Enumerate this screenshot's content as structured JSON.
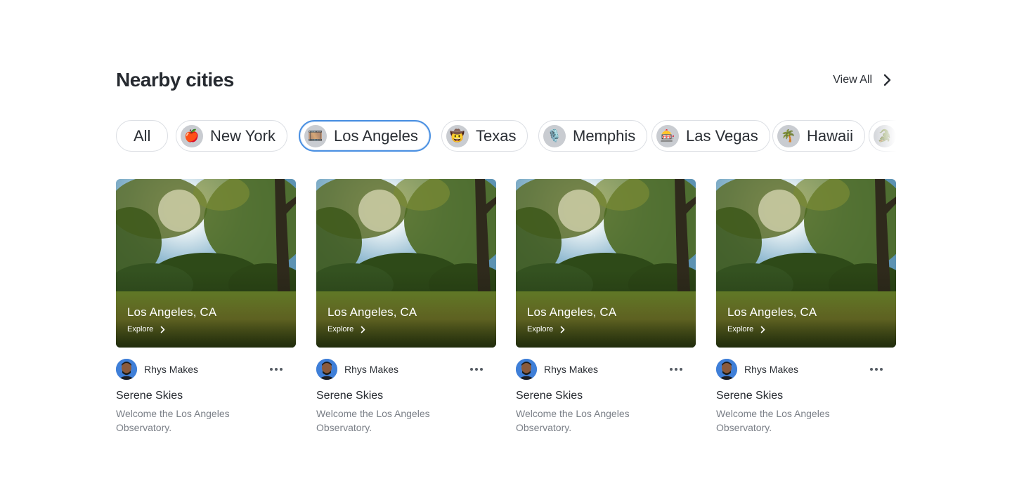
{
  "header": {
    "title": "Nearby cities",
    "view_all_label": "View All",
    "view_all_icon": "chevron-right-icon"
  },
  "chips": [
    {
      "label": "All",
      "icon": null,
      "selected": false
    },
    {
      "label": "New York",
      "icon": "🍎",
      "icon_name": "apple-icon",
      "selected": false
    },
    {
      "label": "Los Angeles",
      "icon": "🎞️",
      "icon_name": "film-icon",
      "selected": true
    },
    {
      "label": "Texas",
      "icon": "🤠",
      "icon_name": "cowboy-icon",
      "selected": false
    },
    {
      "label": "Memphis",
      "icon": "🎙️",
      "icon_name": "microphone-icon",
      "selected": false
    },
    {
      "label": "Las Vegas",
      "icon": "🎰",
      "icon_name": "slot-machine-icon",
      "selected": false
    },
    {
      "label": "Hawaii",
      "icon": "🌴",
      "icon_name": "palm-tree-icon",
      "selected": false
    },
    {
      "label": "",
      "icon": "🐊",
      "icon_name": "alligator-icon",
      "selected": false
    }
  ],
  "cards": [
    {
      "city": "Los Angeles, CA",
      "explore_label": "Explore",
      "author": "Rhys Makes",
      "title": "Serene Skies",
      "description": "Welcome the Los Angeles Observatory."
    },
    {
      "city": "Los Angeles, CA",
      "explore_label": "Explore",
      "author": "Rhys Makes",
      "title": "Serene Skies",
      "description": "Welcome the Los Angeles Observatory."
    },
    {
      "city": "Los Angeles, CA",
      "explore_label": "Explore",
      "author": "Rhys Makes",
      "title": "Serene Skies",
      "description": "Welcome the Los Angeles Observatory."
    },
    {
      "city": "Los Angeles, CA",
      "explore_label": "Explore",
      "author": "Rhys Makes",
      "title": "Serene Skies",
      "description": "Welcome the Los Angeles Observatory."
    }
  ],
  "colors": {
    "selected_border": "#4a90e2",
    "chip_border": "#dcdfe4",
    "text_primary": "#262a30",
    "text_secondary": "#7a7f87"
  }
}
